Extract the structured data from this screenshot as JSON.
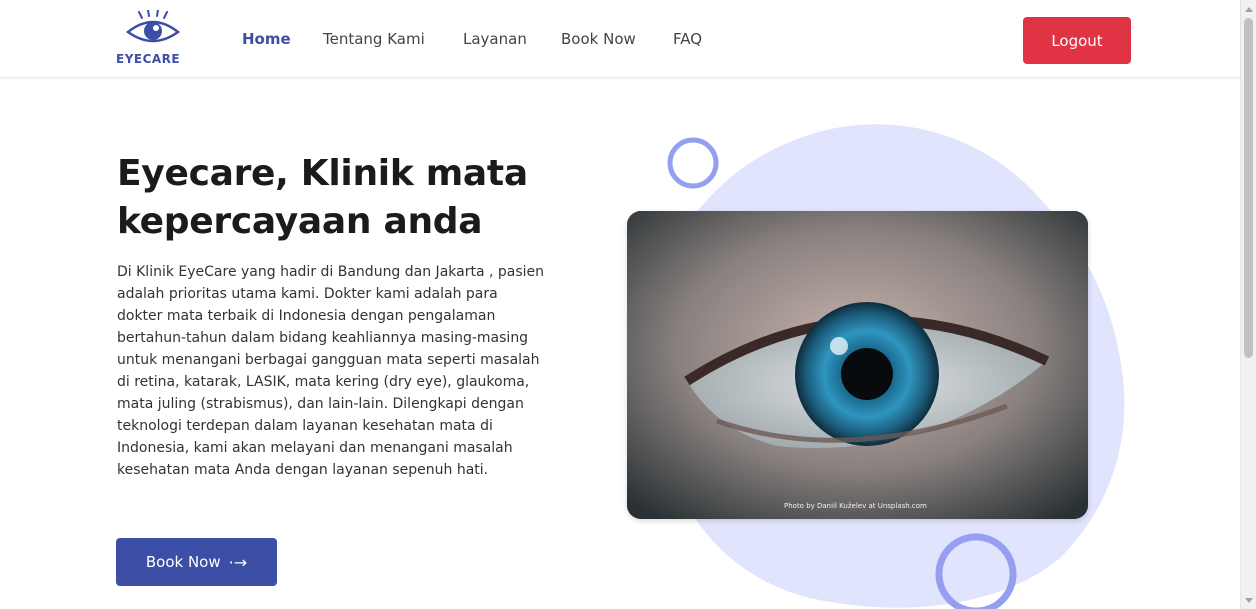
{
  "brand": {
    "name": "EYECARE",
    "logo_icon": "eye-logo-icon"
  },
  "nav": {
    "items": [
      {
        "label": "Home",
        "active": true
      },
      {
        "label": "Tentang Kami",
        "active": false
      },
      {
        "label": "Layanan",
        "active": false
      },
      {
        "label": "Book Now",
        "active": false
      },
      {
        "label": "FAQ",
        "active": false
      }
    ],
    "logout_label": "Logout"
  },
  "hero": {
    "title": "Eyecare, Klinik mata kepercayaan anda",
    "description": "Di Klinik EyeCare yang hadir di Bandung dan Jakarta , pasien adalah prioritas utama kami. Dokter kami adalah para dokter mata terbaik di Indonesia dengan pengalaman bertahun-tahun dalam bidang keahliannya masing-masing untuk menangani berbagai gangguan mata seperti masalah di retina, katarak, LASIK, mata kering (dry eye), glaukoma, mata juling (strabismus), dan lain-lain. Dilengkapi dengan teknologi terdepan dalam layanan kesehatan mata di Indonesia, kami akan melayani dan menangani masalah kesehatan mata Anda dengan layanan sepenuh hati.",
    "cta_label": "Book Now",
    "cta_icon": "arrow-right-icon",
    "photo_credit": "Photo by Daniil Kuželev at Unsplash.com"
  },
  "colors": {
    "brand": "#3d4ea6",
    "logout": "#e03445",
    "blob": "#e1e4fd",
    "ring": "#959ff0"
  }
}
